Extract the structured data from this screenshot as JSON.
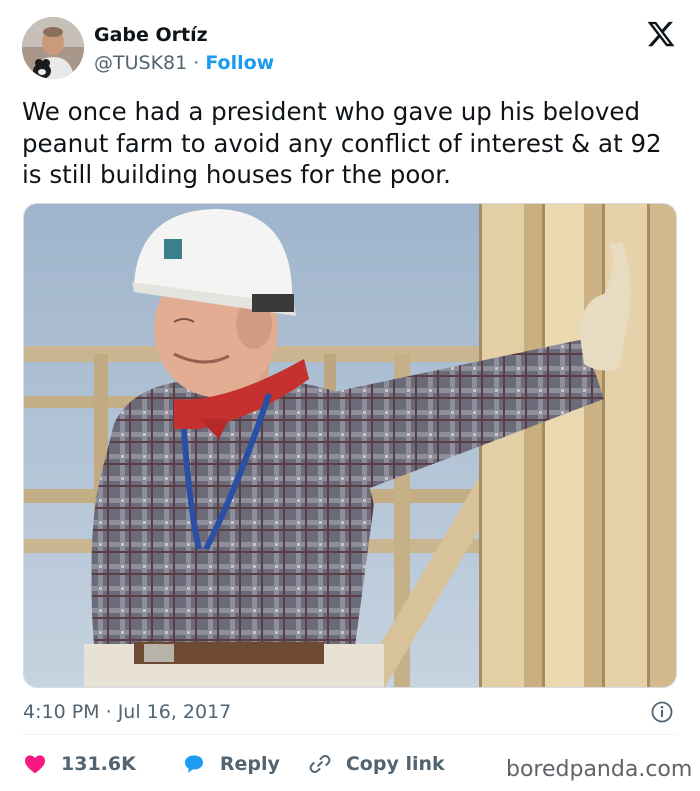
{
  "tweet": {
    "author_name": "Gabe Ortíz",
    "author_handle": "@TUSK81",
    "separator": " · ",
    "follow_label": "Follow",
    "text": "We once had a president who gave up his beloved peanut farm to avoid any conflict of interest & at 92 is still building houses for the poor.",
    "time": "4:10 PM",
    "date_separator": " · ",
    "date": "Jul 16, 2017"
  },
  "actions": {
    "likes_count": "131.6K",
    "reply_label": "Reply",
    "copy_link_label": "Copy link"
  },
  "watermark": "boredpanda.com",
  "icons": {
    "logo": "x-logo-icon",
    "info": "info-icon",
    "like": "heart-icon",
    "reply": "reply-bubble-icon",
    "copy": "link-icon"
  },
  "colors": {
    "heart": "#f91880",
    "reply": "#1d9bf0",
    "follow": "#1d9bf0",
    "text": "#0f1419",
    "muted": "#536471"
  }
}
